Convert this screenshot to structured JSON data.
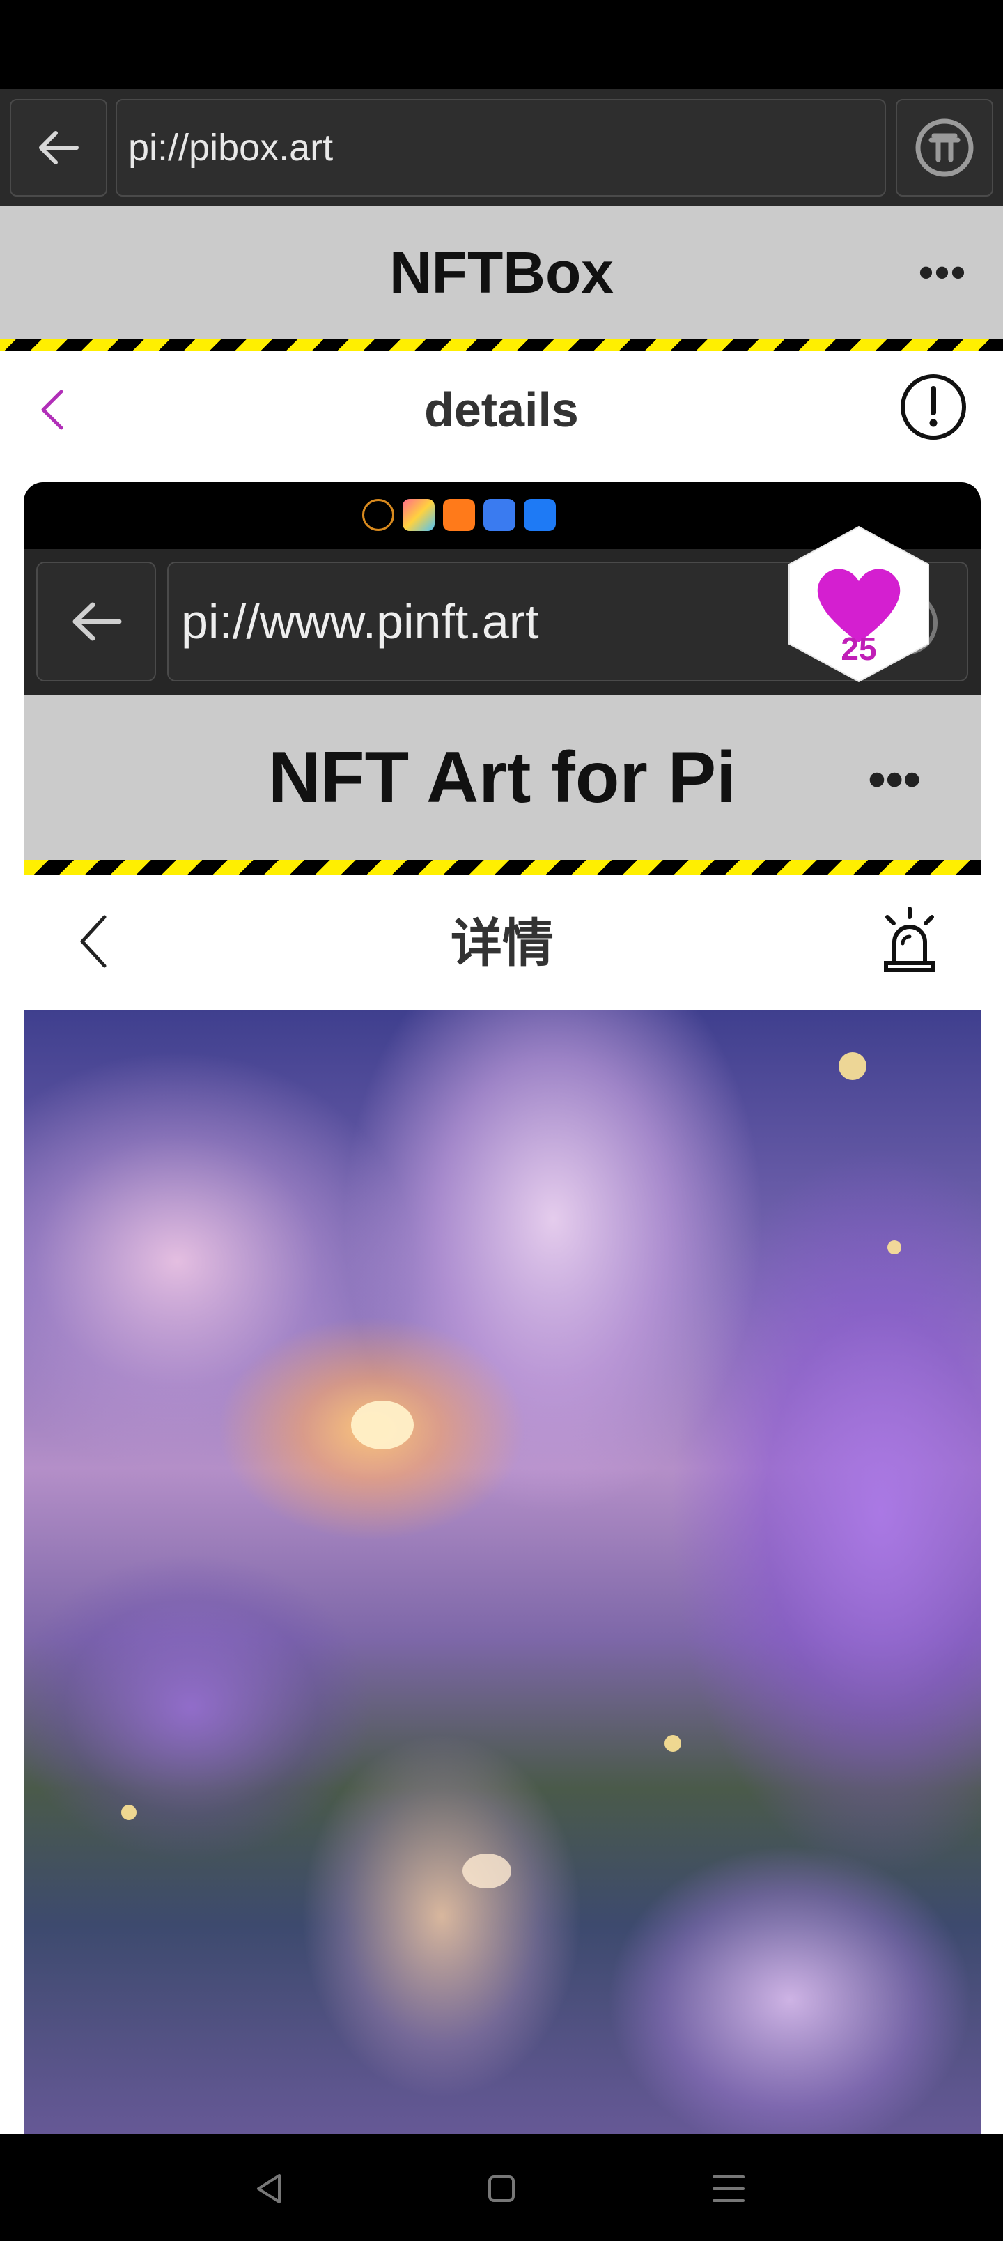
{
  "browser": {
    "url": "pi://pibox.art"
  },
  "app_header": {
    "title": "NFTBox",
    "more_label": "•••"
  },
  "page": {
    "title": "details"
  },
  "embedded_screenshot": {
    "browser": {
      "url": "pi://www.pinft.art"
    },
    "app_header": {
      "title": "NFT Art for Pi",
      "more_label": "•••"
    },
    "page": {
      "title": "详情"
    },
    "status_app_icons": [
      "game-icon",
      "paint-app-icon",
      "video-app-icon",
      "music-app-icon",
      "bulb-app-icon"
    ]
  },
  "like_badge": {
    "count": "25"
  },
  "colors": {
    "accent": "#b12fb8",
    "like_heart": "#d41fd0",
    "header_bg": "#cbcbcb",
    "stripe_yellow": "#ffef00"
  },
  "system_nav": [
    "back-icon",
    "home-icon",
    "menu-icon"
  ]
}
